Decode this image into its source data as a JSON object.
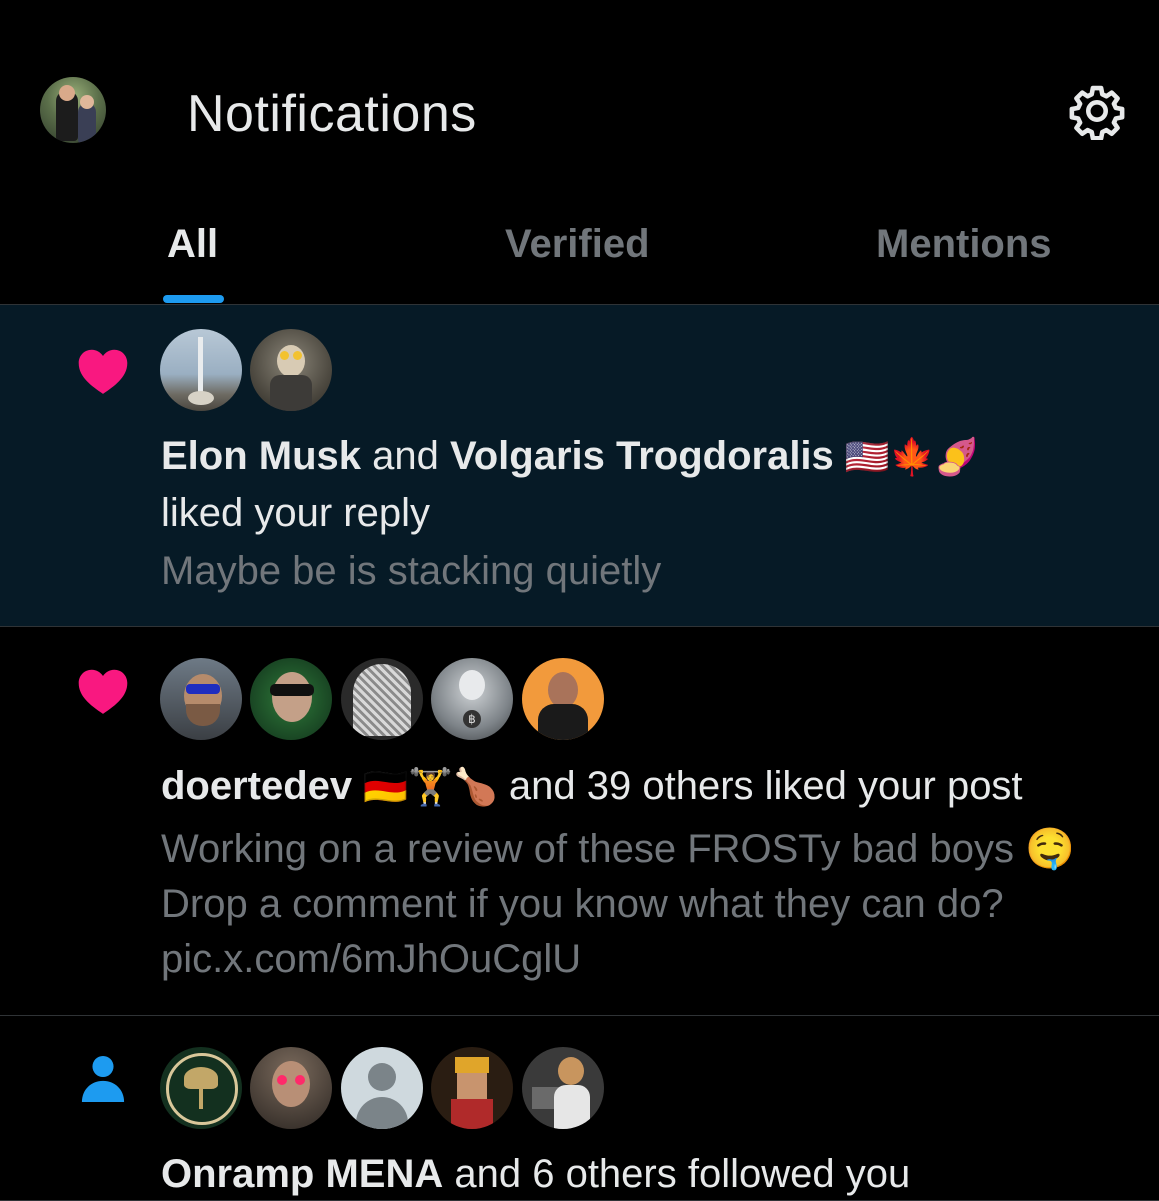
{
  "header": {
    "title": "Notifications",
    "profile_avatar": "profile-photo",
    "settings_icon": "gear-icon"
  },
  "tabs": [
    {
      "label": "All",
      "active": true
    },
    {
      "label": "Verified",
      "active": false
    },
    {
      "label": "Mentions",
      "active": false
    }
  ],
  "colors": {
    "accent": "#1d9bf0",
    "like": "#f91880",
    "highlight_bg": "#061a26",
    "muted": "#71767b"
  },
  "notifications": [
    {
      "type_icon": "heart-icon",
      "actor1": "Elon Musk",
      "joiner": " and ",
      "actor2": "Volgaris Trogdoralis",
      "actor2_emoji": "🇺🇸🍁🍠",
      "action": "liked your reply",
      "snippet": "Maybe be is stacking quietly"
    },
    {
      "type_icon": "heart-icon",
      "actor1": "doertedev",
      "actor1_emoji": "🇩🇪🏋🍗",
      "action": " and 39 others liked your post",
      "snippet_lines": [
        "Working on a review of these FROSTy bad boys 🤤",
        "Drop a comment if you know what they can do?",
        "pic.x.com/6mJhOuCglU"
      ]
    },
    {
      "type_icon": "person-icon",
      "actor1": "Onramp MENA",
      "action": " and 6 others followed you"
    }
  ]
}
